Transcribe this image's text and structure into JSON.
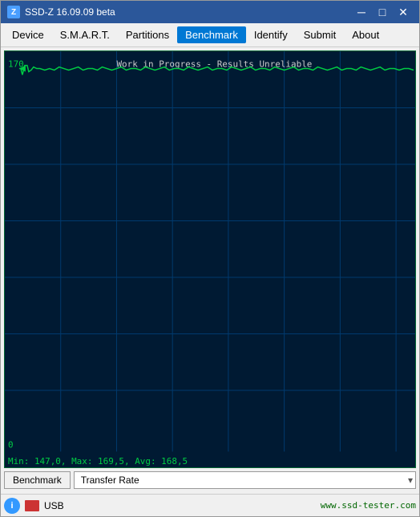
{
  "window": {
    "title": "SSD-Z 16.09.09 beta",
    "icon": "Z"
  },
  "title_controls": {
    "minimize": "─",
    "maximize": "□",
    "close": "✕"
  },
  "menu": {
    "items": [
      {
        "label": "Device",
        "active": false
      },
      {
        "label": "S.M.A.R.T.",
        "active": false
      },
      {
        "label": "Partitions",
        "active": false
      },
      {
        "label": "Benchmark",
        "active": true
      },
      {
        "label": "Identify",
        "active": false
      },
      {
        "label": "Submit",
        "active": false
      },
      {
        "label": "About",
        "active": false
      }
    ]
  },
  "chart": {
    "title": "Work in Progress - Results Unreliable",
    "y_max": "170",
    "y_min": "0",
    "stats": "Min: 147,0, Max: 169,5, Avg: 168,5",
    "color_line": "#00cc44",
    "color_grid": "#003366",
    "color_text": "#00cc44"
  },
  "bottom": {
    "benchmark_label": "Benchmark",
    "dropdown_value": "Transfer Rate",
    "dropdown_arrow": "▾"
  },
  "status": {
    "icon_label": "i",
    "drive_label": "USB",
    "url": "www.ssd-tester.com"
  }
}
